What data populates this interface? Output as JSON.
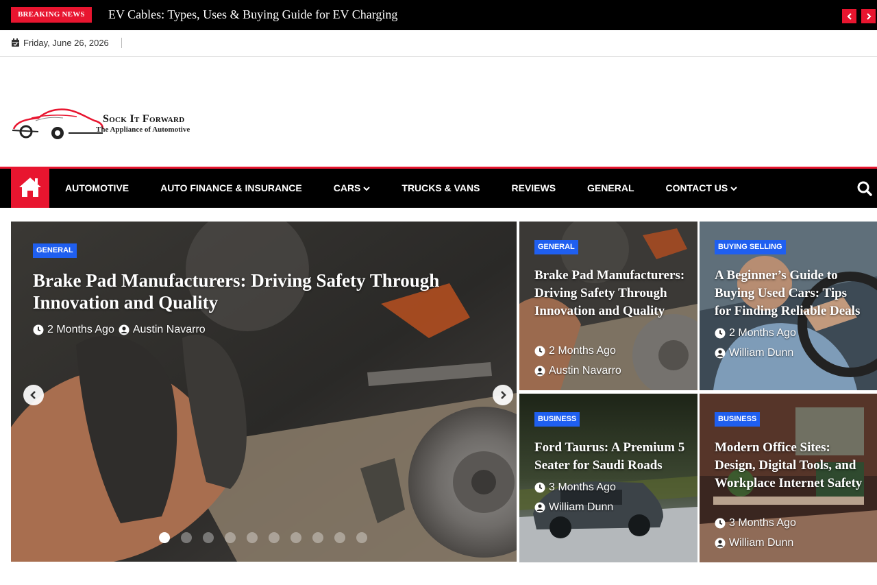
{
  "breaking": {
    "label": "BREAKING NEWS",
    "headline": "EV Cables: Types, Uses & Buying Guide for EV Charging",
    "prev_icon": "chevron-left-icon",
    "next_icon": "chevron-right-icon"
  },
  "topbar": {
    "date": "Friday, June 26, 2026",
    "date_icon": "calendar-icon"
  },
  "logo": {
    "brand": "Sock It Forward",
    "tagline": "The Appliance of Automotive"
  },
  "nav": {
    "home_icon": "home-icon",
    "items": [
      {
        "label": "AUTOMOTIVE"
      },
      {
        "label": "AUTO FINANCE & INSURANCE"
      },
      {
        "label": "CARS",
        "dropdown": true
      },
      {
        "label": "TRUCKS & VANS"
      },
      {
        "label": "REVIEWS"
      },
      {
        "label": "GENERAL"
      },
      {
        "label": "CONTACT US",
        "dropdown": true
      }
    ],
    "search_icon": "search-icon"
  },
  "hero": {
    "category": "GENERAL",
    "title": "Brake Pad Manufacturers: Driving Safety Through Innovation and Quality",
    "time": "2 Months Ago",
    "author": "Austin Navarro",
    "slide_count": 10,
    "active_slide": 1
  },
  "cards": [
    {
      "category": "GENERAL",
      "title": "Brake Pad Manufacturers: Driving Safety Through Innovation and Quality",
      "time": "2 Months Ago",
      "author": "Austin Navarro"
    },
    {
      "category": "BUYING SELLING",
      "title": "A Beginner’s Guide to Buying Used Cars: Tips for Finding Reliable Deals",
      "time": "2 Months Ago",
      "author": "William Dunn"
    },
    {
      "category": "BUSINESS",
      "title": "Ford Taurus: A Premium 5 Seater for Saudi Roads",
      "time": "3 Months Ago",
      "author": "William Dunn"
    },
    {
      "category": "BUSINESS",
      "title": "Modern Office Sites: Design, Digital Tools, and Workplace Internet Safety",
      "time": "3 Months Ago",
      "author": "William Dunn"
    }
  ],
  "colors": {
    "accent": "#e8152f",
    "badge": "#1f5ff0",
    "nav_bg": "#000000"
  }
}
